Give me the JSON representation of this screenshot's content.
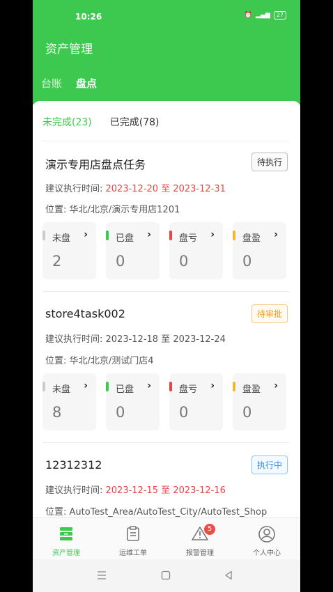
{
  "status": {
    "time": "10:26",
    "battery": "27"
  },
  "header": {
    "title": "资产管理",
    "tabs": [
      "台账",
      "盘点"
    ]
  },
  "subtabs": [
    "未完成(23)",
    "已完成(78)"
  ],
  "tasks": [
    {
      "name": "演示专用店盘点任务",
      "status": "待执行",
      "date_label": "建议执行时间: ",
      "date_start": "2023-12-20",
      "date_sep": " 至 ",
      "date_end": "2023-12-31",
      "location": "位置: 华北/北京/演示专用店1201",
      "stats": [
        {
          "label": "未盘",
          "value": "2"
        },
        {
          "label": "已盘",
          "value": "0"
        },
        {
          "label": "盘亏",
          "value": "0"
        },
        {
          "label": "盘盈",
          "value": "0"
        }
      ]
    },
    {
      "name": "store4task002",
      "status": "待审批",
      "date_label": "建议执行时间: ",
      "date_start": "2023-12-18",
      "date_sep": " 至 ",
      "date_end": "2023-12-24",
      "location": "位置: 华北/北京/测试门店4",
      "stats": [
        {
          "label": "未盘",
          "value": "8"
        },
        {
          "label": "已盘",
          "value": "0"
        },
        {
          "label": "盘亏",
          "value": "0"
        },
        {
          "label": "盘盈",
          "value": "0"
        }
      ]
    },
    {
      "name": "12312312",
      "status": "执行中",
      "date_label": "建议执行时间: ",
      "date_start": "2023-12-15",
      "date_sep": " 至 ",
      "date_end": "2023-12-16",
      "location": "位置: AutoTest_Area/AutoTest_City/AutoTest_Shop"
    }
  ],
  "nav": [
    {
      "label": "资产管理",
      "icon": "asset-icon"
    },
    {
      "label": "运维工单",
      "icon": "workorder-icon"
    },
    {
      "label": "报警管理",
      "icon": "alarm-icon",
      "badge": "5"
    },
    {
      "label": "个人中心",
      "icon": "profile-icon"
    }
  ],
  "colors": {
    "primary": "#3dc94f",
    "accent_red": "#e84545",
    "stat_bars": [
      "#cccccc",
      "#3dc94f",
      "#e84545",
      "#f5b52e"
    ]
  }
}
